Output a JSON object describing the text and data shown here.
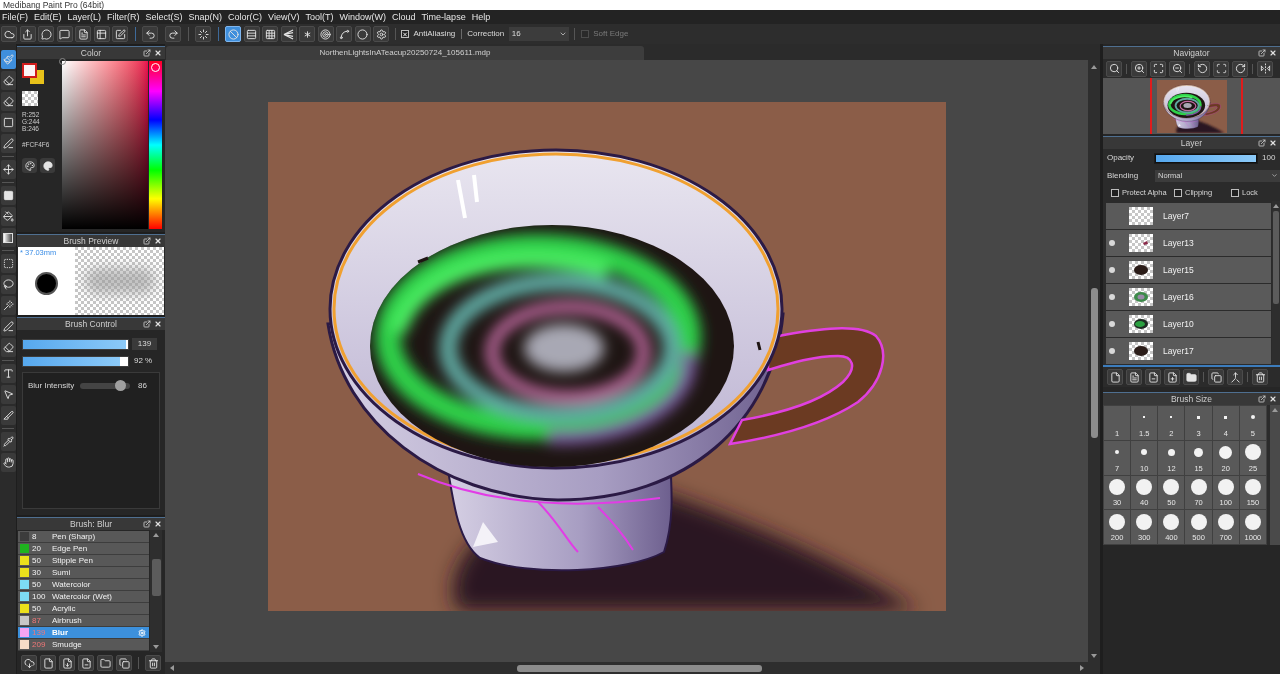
{
  "window": {
    "title": "Medibang Paint Pro (64bit)"
  },
  "menu": [
    "File(F)",
    "Edit(E)",
    "Layer(L)",
    "Filter(R)",
    "Select(S)",
    "Snap(N)",
    "Color(C)",
    "View(V)",
    "Tool(T)",
    "Window(W)",
    "Cloud",
    "Time-lapse",
    "Help"
  ],
  "toolbar": {
    "snap_modes": [
      {
        "selected": true
      },
      {
        "selected": false
      },
      {
        "selected": false
      },
      {
        "selected": false
      },
      {
        "selected": false
      },
      {
        "selected": false
      },
      {
        "selected": false
      },
      {
        "selected": false
      }
    ],
    "antialiasing": {
      "label": "AntiAliasing",
      "checked": true
    },
    "correction": {
      "label": "Correction",
      "value": "16"
    },
    "soft_edge": {
      "label": "Soft Edge",
      "checked": false,
      "disabled": true
    }
  },
  "tools": [
    {
      "selected": true
    },
    {
      "selected": false
    },
    {
      "selected": false
    },
    {
      "selected": false
    },
    {
      "selected": false
    },
    {
      "selected": false
    },
    {
      "selected": false
    },
    {
      "selected": false
    },
    {
      "selected": false
    },
    {
      "selected": false
    },
    {
      "selected": false
    },
    {
      "selected": false
    },
    {
      "selected": false
    },
    {
      "selected": false
    },
    {
      "selected": false
    },
    {
      "selected": false
    },
    {
      "selected": false
    },
    {
      "selected": false
    },
    {
      "selected": false
    }
  ],
  "color_panel": {
    "title": "Color",
    "readout": [
      "R:252",
      "G:244",
      "B:246"
    ],
    "hex": "#FCF4F6"
  },
  "brush_preview": {
    "title": "Brush Preview",
    "size": "* 37.03mm"
  },
  "brush_control": {
    "title": "Brush Control",
    "size": {
      "level": 0.985,
      "value": "139"
    },
    "opacity": {
      "level": 0.92,
      "value": "92 %"
    },
    "blur_intensity": {
      "label": "Blur Intensity",
      "level": 0.8,
      "value": "86"
    }
  },
  "brush_list": {
    "title": "Brush: Blur",
    "items": [
      {
        "size": "8",
        "name": "Pen (Sharp)",
        "color": "#3c3c3c",
        "size_highlighted": false,
        "selected": false
      },
      {
        "size": "20",
        "name": "Edge Pen",
        "color": "#1fb31f",
        "size_highlighted": false,
        "selected": false
      },
      {
        "size": "50",
        "name": "Stipple Pen",
        "color": "#ece11c",
        "size_highlighted": false,
        "selected": false
      },
      {
        "size": "30",
        "name": "Sumi",
        "color": "#ece11c",
        "size_highlighted": false,
        "selected": false
      },
      {
        "size": "50",
        "name": "Watercolor",
        "color": "#7ddcf4",
        "size_highlighted": false,
        "selected": false
      },
      {
        "size": "100",
        "name": "Watercolor (Wet)",
        "color": "#7ddcf4",
        "size_highlighted": false,
        "selected": false
      },
      {
        "size": "50",
        "name": "Acrylic",
        "color": "#ece11c",
        "size_highlighted": false,
        "selected": false
      },
      {
        "size": "87",
        "name": "Airbrush",
        "color": "#c8c8c8",
        "size_highlighted": true,
        "selected": false
      },
      {
        "size": "139",
        "name": "Blur",
        "color": "#f6a4f2",
        "size_highlighted": true,
        "selected": true
      },
      {
        "size": "209",
        "name": "Smudge",
        "color": "#f6dcc8",
        "size_highlighted": true,
        "selected": false
      }
    ]
  },
  "document": {
    "tab": "NorthenLightsInATeacup20250724_105611.mdp"
  },
  "navigator": {
    "title": "Navigator"
  },
  "layer_panel": {
    "title": "Layer",
    "opacity": {
      "label": "Opacity",
      "level": 1,
      "value": "100"
    },
    "blending": {
      "label": "Blending",
      "value": "Normal"
    },
    "options": [
      {
        "label": "Protect Alpha",
        "checked": false
      },
      {
        "label": "Clipping",
        "checked": false
      },
      {
        "label": "Lock",
        "checked": false
      }
    ],
    "layers": [
      {
        "name": "Layer7",
        "visible": false,
        "selected": false
      },
      {
        "name": "Layer13",
        "visible": true,
        "selected": false
      },
      {
        "name": "Layer15",
        "visible": true,
        "selected": false
      },
      {
        "name": "Layer16",
        "visible": true,
        "selected": false
      },
      {
        "name": "Layer10",
        "visible": true,
        "selected": false
      },
      {
        "name": "Layer17",
        "visible": true,
        "selected": false
      }
    ]
  },
  "brush_size": {
    "title": "Brush Size",
    "sizes": [
      "1",
      "1.5",
      "2",
      "3",
      "4",
      "5",
      "7",
      "10",
      "12",
      "15",
      "20",
      "25",
      "30",
      "40",
      "50",
      "70",
      "100",
      "150",
      "200",
      "300",
      "400",
      "500",
      "700",
      "1000"
    ]
  }
}
